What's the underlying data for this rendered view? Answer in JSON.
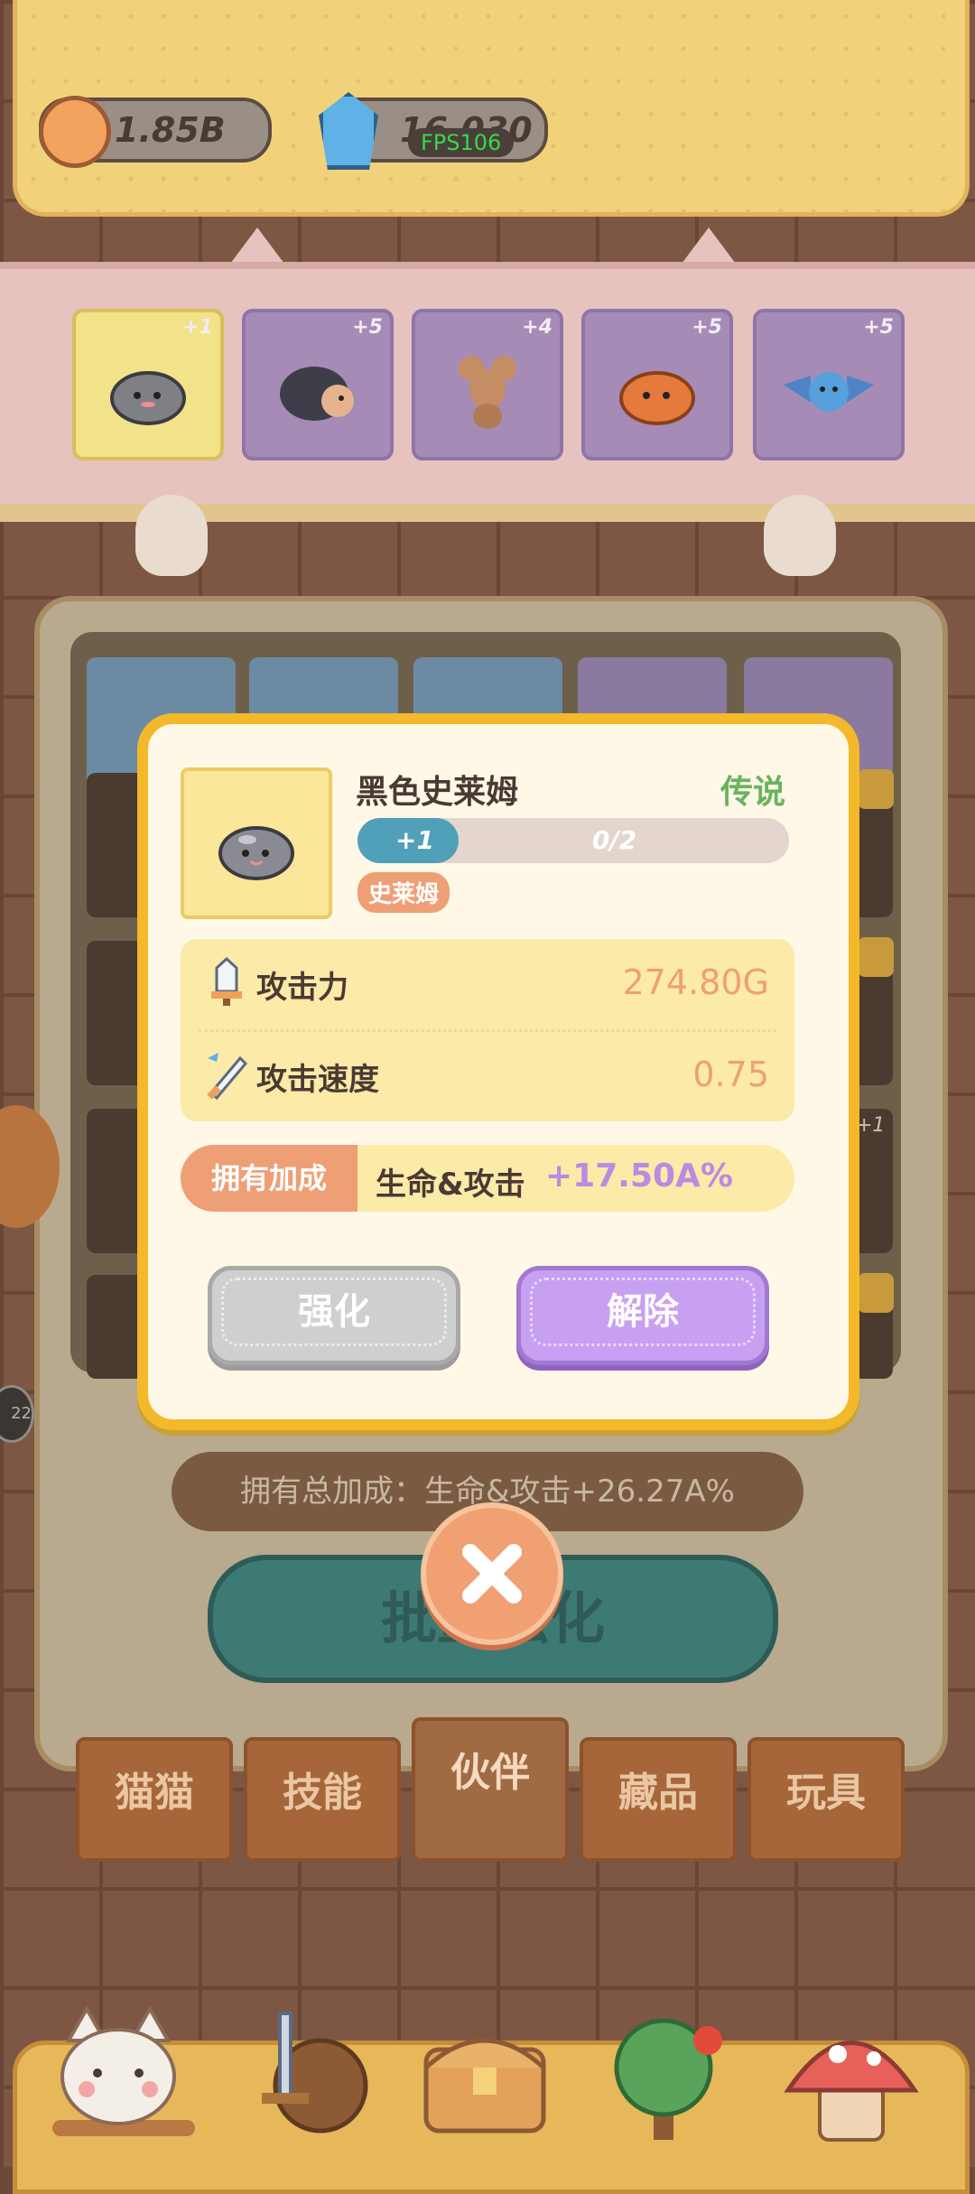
{
  "hud": {
    "coins": "1.85B",
    "gems": "16,030",
    "fps": "FPS106"
  },
  "team": {
    "slots": [
      {
        "level": "+1",
        "creature": "slime",
        "selected": true
      },
      {
        "level": "+5",
        "creature": "hedgehog",
        "selected": false
      },
      {
        "level": "+4",
        "creature": "mouse",
        "selected": false
      },
      {
        "level": "+5",
        "creature": "orange-slime",
        "selected": false
      },
      {
        "level": "+5",
        "creature": "bat",
        "selected": false
      }
    ]
  },
  "dialog": {
    "name": "黑色史莱姆",
    "rarity": "传说",
    "level": "+1",
    "progress_text": "0/2",
    "progress_fraction": 0.0,
    "type": "史莱姆",
    "stats": [
      {
        "label": "攻击力",
        "value": "274.80G"
      },
      {
        "label": "攻击速度",
        "value": "0.75"
      }
    ],
    "bonus_label": "拥有加成",
    "bonus_text": "生命&攻击",
    "bonus_value": "+17.50A%",
    "upgrade_label": "强化",
    "remove_label": "解除"
  },
  "background": {
    "total_bonus": "拥有总加成：生命&攻击+26.27A%",
    "batch_label": "批量强化",
    "side_badge": "22",
    "slot_lock_level": "+1"
  },
  "tabs": [
    "猫猫",
    "技能",
    "伙伴",
    "藏品",
    "玩具"
  ],
  "active_tab": 2,
  "nav": [
    "cat",
    "sword-shield",
    "treasure-chest",
    "tree",
    "mushroom-house"
  ],
  "colors": {
    "rarity": "#6ab35e",
    "bonus_value": "#b98be2",
    "stat_value": "#ef9f75",
    "dialog_border": "#f3b92b"
  }
}
